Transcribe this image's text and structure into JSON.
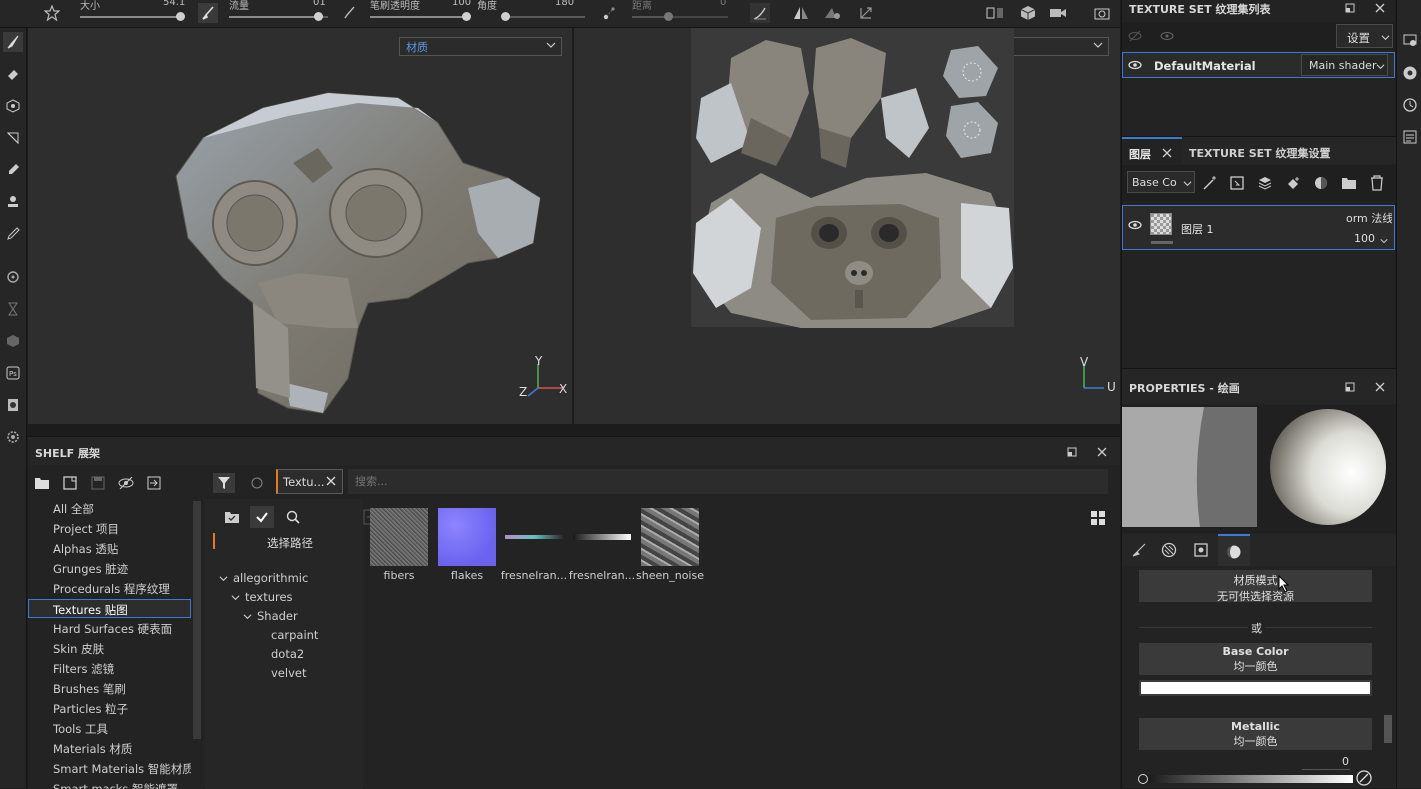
{
  "toolbar": {
    "size_label": "大小",
    "size_value": "54.1",
    "size_fraction": 0.97,
    "flow_label": "流量",
    "flow_value": "01",
    "flow_fraction": 0.9,
    "stroke_opacity_label": "笔刷透明度",
    "stroke_opacity_value": "100",
    "stroke_opacity_fraction": 1.0,
    "angle_label": "角度",
    "angle_value": "180",
    "angle_fraction": 0.0,
    "spacing_label": "距离",
    "spacing_value": "0",
    "spacing_fraction": 0.38
  },
  "viewport3d": {
    "material_dropdown": "材质",
    "axis_y": "Y",
    "axis_x": "X",
    "axis_z": "Z"
  },
  "viewport2d": {
    "material_dropdown": "材质",
    "axis_v": "V",
    "axis_u": "U"
  },
  "shelf": {
    "title": "SHELF 展架",
    "categories": [
      "All 全部",
      "Project 项目",
      "Alphas 透贴",
      "Grunges 脏迹",
      "Procedurals 程序纹理",
      "Textures 贴图",
      "Hard Surfaces 硬表面",
      "Skin 皮肤",
      "Filters 滤镜",
      "Brushes 笔刷",
      "Particles 粒子",
      "Tools 工具",
      "Materials 材质",
      "Smart Materials 智能材质",
      "Smart masks 智能遮罩"
    ],
    "selected_category_index": 5,
    "filter_tab": "Textu...",
    "search_placeholder": "搜索...",
    "select_path": "选择路径",
    "tree": [
      "allegorithmic",
      "textures",
      "Shader",
      "carpaint",
      "dota2",
      "velvet"
    ],
    "thumbs": [
      "fibers",
      "flakes",
      "fresnelran...",
      "fresnelran...",
      "sheen_noise"
    ]
  },
  "texture_set_list": {
    "title": "TEXTURE SET 纹理集列表",
    "settings_button": "设置",
    "material_name": "DefaultMaterial",
    "shader_dropdown": "Main shader"
  },
  "layers": {
    "tab_layers": "图层",
    "tab_settings": "TEXTURE SET 纹理集设置",
    "channel_dropdown": "Base Co",
    "layer_name": "图层 1",
    "blend_mode": "orm 法线",
    "opacity": "100"
  },
  "properties": {
    "title": "PROPERTIES - 绘画",
    "material_mode_title": "材质模式",
    "material_mode_sub": "无可供选择资源",
    "or_text": "或",
    "base_color_title": "Base Color",
    "base_color_sub": "均一颜色",
    "metallic_title": "Metallic",
    "metallic_sub": "均一颜色",
    "metallic_value": "0"
  },
  "colors": {
    "accent": "#3b7bd6",
    "orange": "#e07b2a"
  }
}
